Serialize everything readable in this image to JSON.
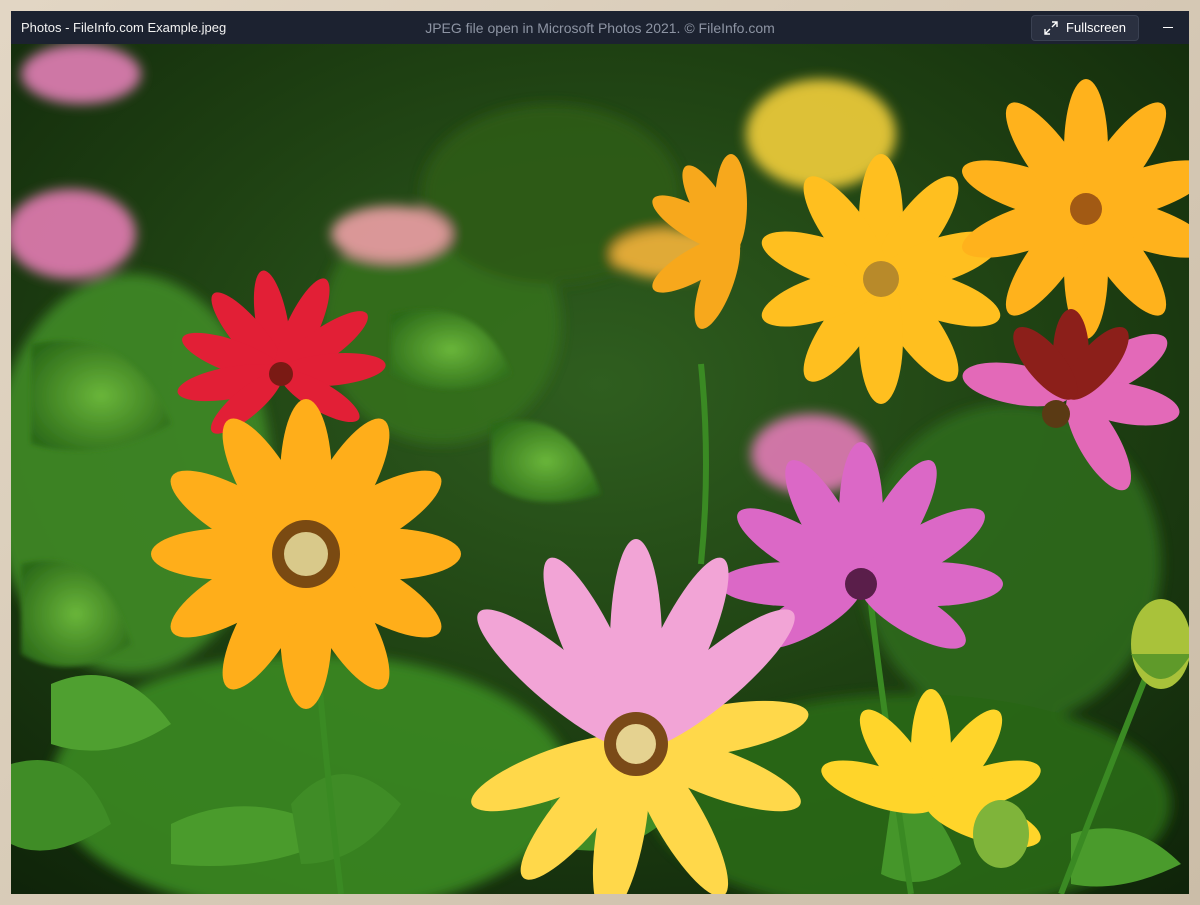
{
  "window": {
    "title": "Photos - FileInfo.com Example.jpeg",
    "caption": "JPEG file open in Microsoft Photos 2021. © FileInfo.com"
  },
  "toolbar": {
    "fullscreen_label": "Fullscreen",
    "fullscreen_icon": "expand-arrows-icon",
    "minimize_icon": "minimize-icon"
  },
  "photo": {
    "subject": "image-of-colorful-daisies",
    "colors": {
      "leaf": "#3f8f2a",
      "yellow": "#ffbf1f",
      "pink": "#d96ac4",
      "red": "#e2243a"
    }
  }
}
